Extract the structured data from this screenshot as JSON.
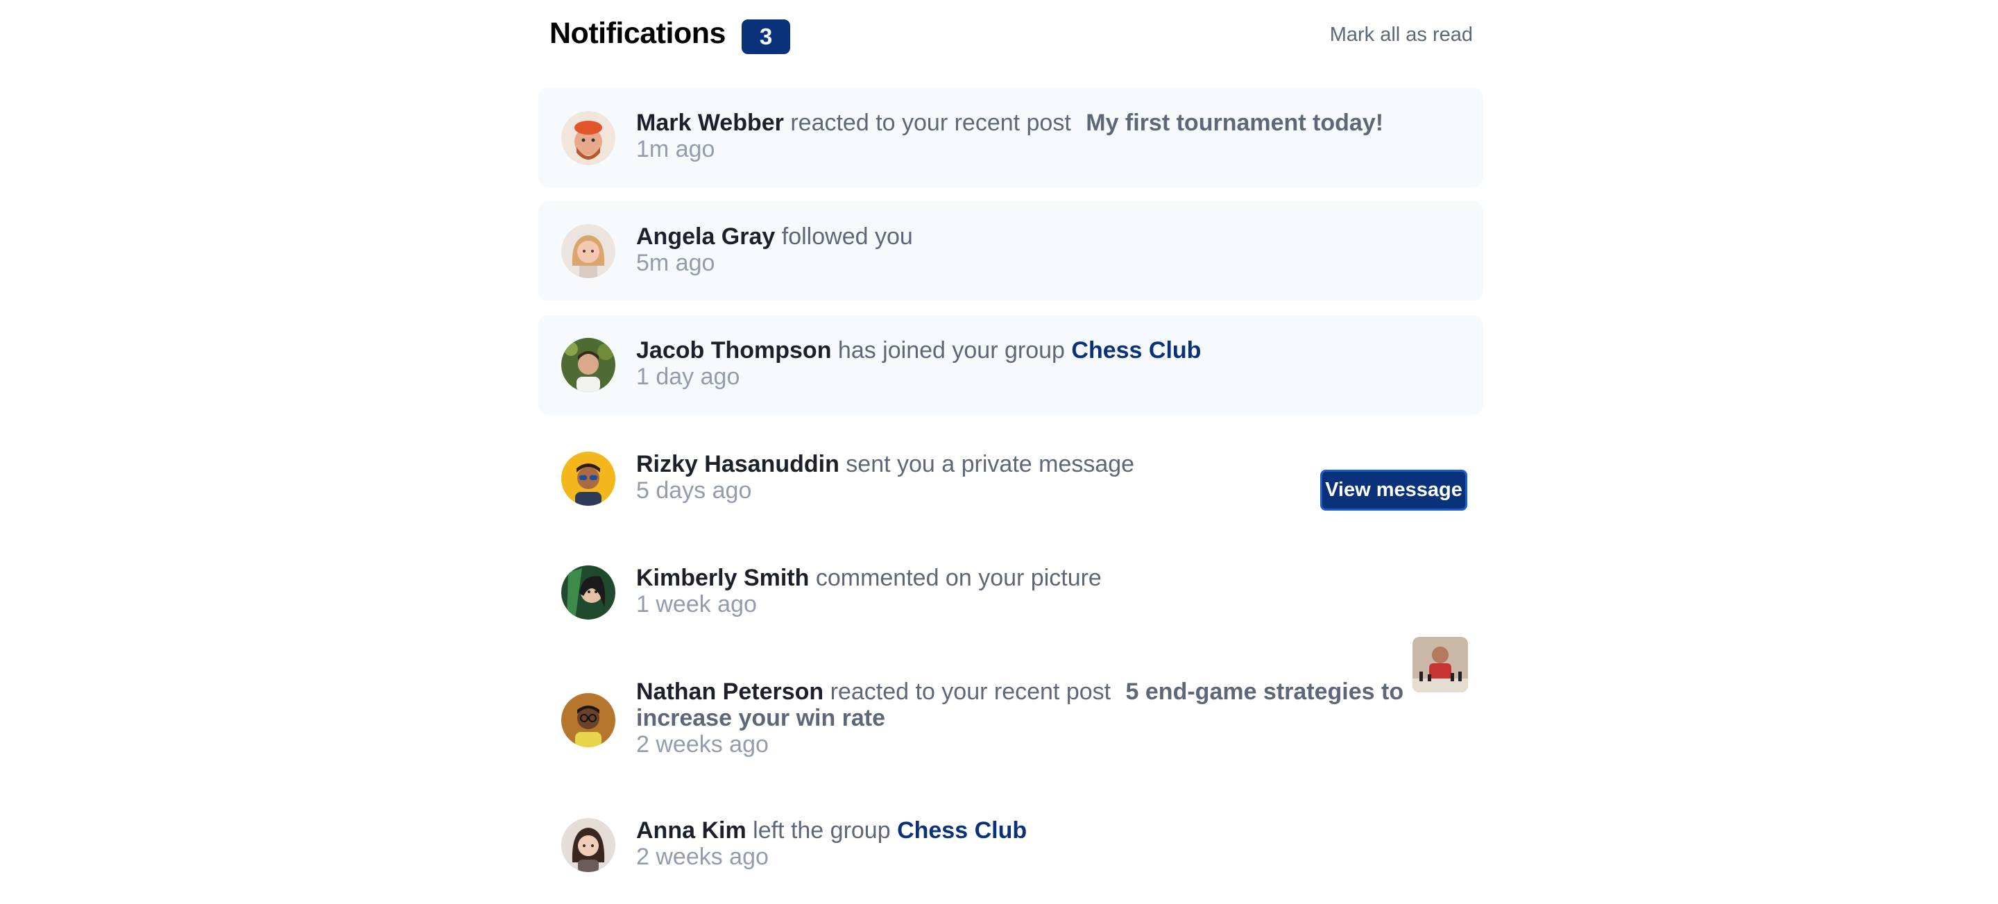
{
  "header": {
    "title": "Notifications",
    "count": "3",
    "mark_all_label": "Mark all as read"
  },
  "notifications": [
    {
      "name": "Mark Webber",
      "action": "reacted to your recent post",
      "target": "My first tournament today!",
      "time": "1m ago",
      "unread": true,
      "avatar_icon": "avatar-mark-webber"
    },
    {
      "name": "Angela Gray",
      "action": "followed you",
      "time": "5m ago",
      "unread": true,
      "avatar_icon": "avatar-angela-gray"
    },
    {
      "name": "Jacob Thompson",
      "action": "has joined your group",
      "target": "Chess Club",
      "time": "1 day ago",
      "unread": true,
      "avatar_icon": "avatar-jacob-thompson"
    },
    {
      "name": "Rizky Hasanuddin",
      "action": "sent you a private message",
      "time": "5 days ago",
      "unread": false,
      "button_label": "View message",
      "avatar_icon": "avatar-rizky-hasanuddin"
    },
    {
      "name": "Kimberly Smith",
      "action": "commented on your picture",
      "time": "1 week ago",
      "unread": false,
      "avatar_icon": "avatar-kimberly-smith",
      "picture_icon": "chess-picture-thumbnail"
    },
    {
      "name": "Nathan Peterson",
      "action": "reacted to your recent post",
      "target": "5 end-game strategies to increase your win rate",
      "time": "2 weeks ago",
      "unread": false,
      "avatar_icon": "avatar-nathan-peterson"
    },
    {
      "name": "Anna Kim",
      "action": "left the group",
      "target": "Chess Club",
      "time": "2 weeks ago",
      "unread": false,
      "avatar_icon": "avatar-anna-kim"
    }
  ],
  "colors": {
    "accent": "#0a327b",
    "unread_bg": "#f7fafd",
    "text_dark": "#1c202b",
    "text_muted": "#5e6778",
    "text_light": "#939cad"
  }
}
